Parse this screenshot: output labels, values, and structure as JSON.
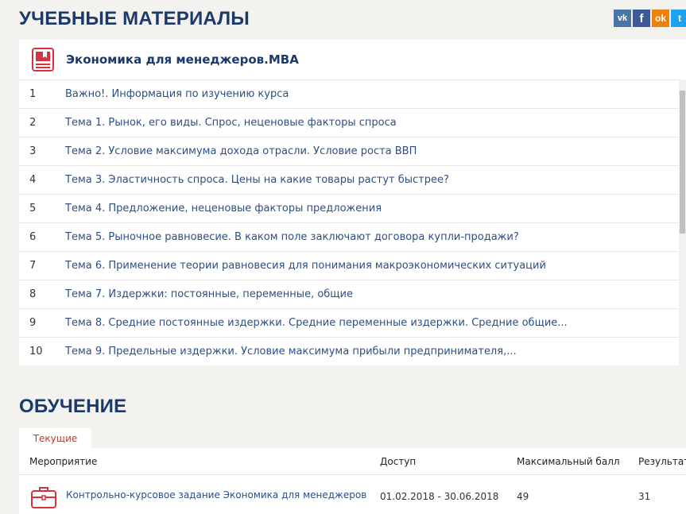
{
  "materials": {
    "title": "УЧЕБНЫЕ МАТЕРИАЛЫ",
    "course_name": "Экономика для менеджеров.MBA",
    "topics": [
      {
        "num": "1",
        "title": "Важно!. Информация по изучению курса"
      },
      {
        "num": "2",
        "title": "Тема 1. Рынок, его виды. Спрос, неценовые факторы спроса"
      },
      {
        "num": "3",
        "title": "Тема 2. Условие максимума дохода отрасли. Условие роста ВВП"
      },
      {
        "num": "4",
        "title": "Тема 3. Эластичность спроса. Цены на какие товары растут быстрее?"
      },
      {
        "num": "5",
        "title": "Тема 4. Предложение, неценовые факторы предложения"
      },
      {
        "num": "6",
        "title": "Тема 5. Рыночное равновесие. В каком поле заключают договора купли-продажи?"
      },
      {
        "num": "7",
        "title": "Тема 6. Применение теории равновесия для понимания макроэкономических ситуаций"
      },
      {
        "num": "8",
        "title": "Тема 7. Издержки: постоянные, переменные, общие"
      },
      {
        "num": "9",
        "title": "Тема 8. Средние постоянные издержки. Средние переменные издержки. Средние общие..."
      },
      {
        "num": "10",
        "title": "Тема 9. Предельные издержки. Условие максимума прибыли предпринимателя,..."
      }
    ]
  },
  "social": {
    "vk": "vk",
    "fb": "f",
    "ok": "ok",
    "tw": "t"
  },
  "training": {
    "title": "ОБУЧЕНИЕ",
    "tab_current": "Текущие",
    "columns": {
      "event": "Мероприятие",
      "access": "Доступ",
      "max_score": "Максимальный балл",
      "result": "Результат"
    },
    "rows": [
      {
        "event": "Контрольно-курсовое задание Экономика для менеджеров",
        "access": "01.02.2018 - 30.06.2018",
        "max_score": "49",
        "result": "31"
      }
    ]
  },
  "colors": {
    "heading": "#1b3a6b",
    "link": "#2c4f86",
    "accent_red": "#d9323f",
    "background": "#f3f2ef"
  }
}
